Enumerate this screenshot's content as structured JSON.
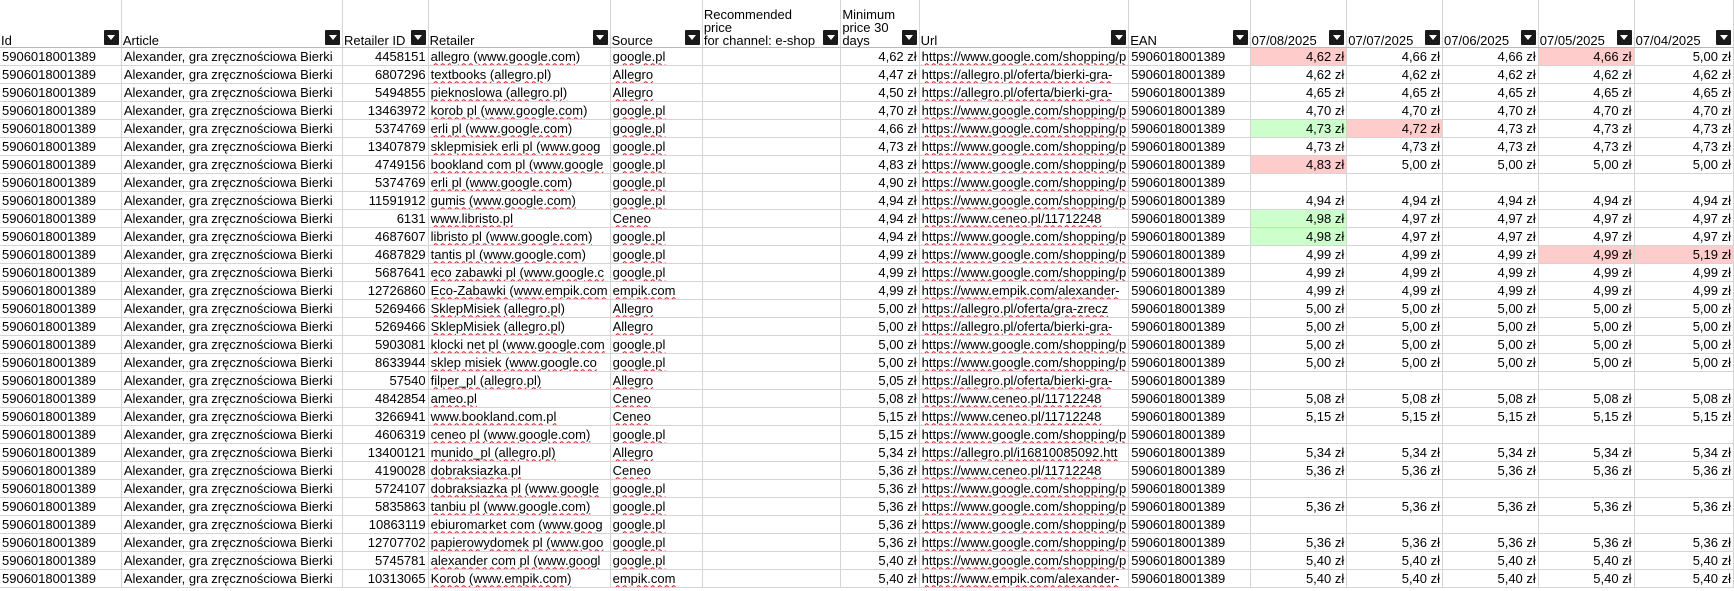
{
  "sheet": {
    "columns": [
      {
        "key": "id",
        "label": "Id"
      },
      {
        "key": "article",
        "label": "Article"
      },
      {
        "key": "retailer_id",
        "label": "Retailer ID"
      },
      {
        "key": "retailer",
        "label": "Retailer"
      },
      {
        "key": "source",
        "label": "Source"
      },
      {
        "key": "recommended",
        "label": "Recommended price\nfor channel: e-shop"
      },
      {
        "key": "min30",
        "label": "Minimum\nprice 30\ndays"
      },
      {
        "key": "url",
        "label": "Url"
      },
      {
        "key": "ean",
        "label": "EAN"
      },
      {
        "key": "d1",
        "label": "07/08/2025"
      },
      {
        "key": "d2",
        "label": "07/07/2025"
      },
      {
        "key": "d3",
        "label": "07/06/2025"
      },
      {
        "key": "d4",
        "label": "07/05/2025"
      },
      {
        "key": "d5",
        "label": "07/04/2025"
      }
    ],
    "rows": [
      [
        "5906018001389",
        "Alexander, gra zręcznościowa Bierki",
        "4458151",
        "allegro (www.google.com)",
        "google.pl",
        "",
        "4,62 zł",
        "https://www.google.com/shopping/p",
        "5906018001389",
        "4,62 zł",
        "4,66 zł",
        "4,66 zł",
        "4,66 zł",
        "5,00 zł"
      ],
      [
        "5906018001389",
        "Alexander, gra zręcznościowa Bierki",
        "6807296",
        "textbooks (allegro.pl)",
        "Allegro",
        "",
        "4,47 zł",
        "https://allegro.pl/oferta/bierki-gra-",
        "5906018001389",
        "4,62 zł",
        "4,62 zł",
        "4,62 zł",
        "4,62 zł",
        "4,62 zł"
      ],
      [
        "5906018001389",
        "Alexander, gra zręcznościowa Bierki",
        "5494855",
        "pieknoslowa (allegro.pl)",
        "Allegro",
        "",
        "4,50 zł",
        "https://allegro.pl/oferta/bierki-gra-",
        "5906018001389",
        "4,65 zł",
        "4,65 zł",
        "4,65 zł",
        "4,65 zł",
        "4,65 zł"
      ],
      [
        "5906018001389",
        "Alexander, gra zręcznościowa Bierki",
        "13463972",
        "korob pl (www.google.com)",
        "google.pl",
        "",
        "4,70 zł",
        "https://www.google.com/shopping/p",
        "5906018001389",
        "4,70 zł",
        "4,70 zł",
        "4,70 zł",
        "4,70 zł",
        "4,70 zł"
      ],
      [
        "5906018001389",
        "Alexander, gra zręcznościowa Bierki",
        "5374769",
        "erli pl (www.google.com)",
        "google.pl",
        "",
        "4,66 zł",
        "https://www.google.com/shopping/p",
        "5906018001389",
        "4,73 zł",
        "4,72 zł",
        "4,73 zł",
        "4,73 zł",
        "4,73 zł"
      ],
      [
        "5906018001389",
        "Alexander, gra zręcznościowa Bierki",
        "13407879",
        "sklepmisiek erli pl (www.goog",
        "google.pl",
        "",
        "4,73 zł",
        "https://www.google.com/shopping/p",
        "5906018001389",
        "4,73 zł",
        "4,73 zł",
        "4,73 zł",
        "4,73 zł",
        "4,73 zł"
      ],
      [
        "5906018001389",
        "Alexander, gra zręcznościowa Bierki",
        "4749156",
        "bookland com pl (www.google",
        "google.pl",
        "",
        "4,83 zł",
        "https://www.google.com/shopping/p",
        "5906018001389",
        "4,83 zł",
        "5,00 zł",
        "5,00 zł",
        "5,00 zł",
        "5,00 zł"
      ],
      [
        "5906018001389",
        "Alexander, gra zręcznościowa Bierki",
        "5374769",
        "erli pl (www.google.com)",
        "google.pl",
        "",
        "4,90 zł",
        "https://www.google.com/shopping/p",
        "5906018001389",
        "",
        "",
        "",
        "",
        ""
      ],
      [
        "5906018001389",
        "Alexander, gra zręcznościowa Bierki",
        "11591912",
        "gumis (www.google.com)",
        "google.pl",
        "",
        "4,94 zł",
        "https://www.google.com/shopping/p",
        "5906018001389",
        "4,94 zł",
        "4,94 zł",
        "4,94 zł",
        "4,94 zł",
        "4,94 zł"
      ],
      [
        "5906018001389",
        "Alexander, gra zręcznościowa Bierki",
        "6131",
        "www.libristo.pl",
        "Ceneo",
        "",
        "4,94 zł",
        "https://www.ceneo.pl/11712248",
        "5906018001389",
        "4,98 zł",
        "4,97 zł",
        "4,97 zł",
        "4,97 zł",
        "4,97 zł"
      ],
      [
        "5906018001389",
        "Alexander, gra zręcznościowa Bierki",
        "4687607",
        "libristo pl (www.google.com)",
        "google.pl",
        "",
        "4,94 zł",
        "https://www.google.com/shopping/p",
        "5906018001389",
        "4,98 zł",
        "4,97 zł",
        "4,97 zł",
        "4,97 zł",
        "4,97 zł"
      ],
      [
        "5906018001389",
        "Alexander, gra zręcznościowa Bierki",
        "4687829",
        "tantis pl (www.google.com)",
        "google.pl",
        "",
        "4,99 zł",
        "https://www.google.com/shopping/p",
        "5906018001389",
        "4,99 zł",
        "4,99 zł",
        "4,99 zł",
        "4,99 zł",
        "5,19 zł"
      ],
      [
        "5906018001389",
        "Alexander, gra zręcznościowa Bierki",
        "5687641",
        "eco zabawki pl (www.google.c",
        "google.pl",
        "",
        "4,99 zł",
        "https://www.google.com/shopping/p",
        "5906018001389",
        "4,99 zł",
        "4,99 zł",
        "4,99 zł",
        "4,99 zł",
        "4,99 zł"
      ],
      [
        "5906018001389",
        "Alexander, gra zręcznościowa Bierki",
        "12726860",
        "Eco-Zabawki (www.empik.com",
        "empik.com",
        "",
        "4,99 zł",
        "https://www.empik.com/alexander-",
        "5906018001389",
        "4,99 zł",
        "4,99 zł",
        "4,99 zł",
        "4,99 zł",
        "4,99 zł"
      ],
      [
        "5906018001389",
        "Alexander, gra zręcznościowa Bierki",
        "5269466",
        "SklepMisiek (allegro.pl)",
        "Allegro",
        "",
        "5,00 zł",
        "https://allegro.pl/oferta/gra-zrecz",
        "5906018001389",
        "5,00 zł",
        "5,00 zł",
        "5,00 zł",
        "5,00 zł",
        "5,00 zł"
      ],
      [
        "5906018001389",
        "Alexander, gra zręcznościowa Bierki",
        "5269466",
        "SklepMisiek (allegro.pl)",
        "Allegro",
        "",
        "5,00 zł",
        "https://allegro.pl/oferta/bierki-gra-",
        "5906018001389",
        "5,00 zł",
        "5,00 zł",
        "5,00 zł",
        "5,00 zł",
        "5,00 zł"
      ],
      [
        "5906018001389",
        "Alexander, gra zręcznościowa Bierki",
        "5903081",
        "klocki net pl (www.google.com",
        "google.pl",
        "",
        "5,00 zł",
        "https://www.google.com/shopping/p",
        "5906018001389",
        "5,00 zł",
        "5,00 zł",
        "5,00 zł",
        "5,00 zł",
        "5,00 zł"
      ],
      [
        "5906018001389",
        "Alexander, gra zręcznościowa Bierki",
        "8633944",
        "sklep misiek (www.google.co",
        "google.pl",
        "",
        "5,00 zł",
        "https://www.google.com/shopping/p",
        "5906018001389",
        "5,00 zł",
        "5,00 zł",
        "5,00 zł",
        "5,00 zł",
        "5,00 zł"
      ],
      [
        "5906018001389",
        "Alexander, gra zręcznościowa Bierki",
        "57540",
        "filper_pl (allegro.pl)",
        "Allegro",
        "",
        "5,05 zł",
        "https://allegro.pl/oferta/bierki-gra-",
        "5906018001389",
        "",
        "",
        "",
        "",
        ""
      ],
      [
        "5906018001389",
        "Alexander, gra zręcznościowa Bierki",
        "4842854",
        "ameo.pl",
        "Ceneo",
        "",
        "5,08 zł",
        "https://www.ceneo.pl/11712248",
        "5906018001389",
        "5,08 zł",
        "5,08 zł",
        "5,08 zł",
        "5,08 zł",
        "5,08 zł"
      ],
      [
        "5906018001389",
        "Alexander, gra zręcznościowa Bierki",
        "3266941",
        "www.bookland.com.pl",
        "Ceneo",
        "",
        "5,15 zł",
        "https://www.ceneo.pl/11712248",
        "5906018001389",
        "5,15 zł",
        "5,15 zł",
        "5,15 zł",
        "5,15 zł",
        "5,15 zł"
      ],
      [
        "5906018001389",
        "Alexander, gra zręcznościowa Bierki",
        "4606319",
        "ceneo pl (www.google.com)",
        "google.pl",
        "",
        "5,15 zł",
        "https://www.google.com/shopping/p",
        "5906018001389",
        "",
        "",
        "",
        "",
        ""
      ],
      [
        "5906018001389",
        "Alexander, gra zręcznościowa Bierki",
        "13400121",
        "munido_pl (allegro.pl)",
        "Allegro",
        "",
        "5,34 zł",
        "https://allegro.pl/i16810085092.htt",
        "5906018001389",
        "5,34 zł",
        "5,34 zł",
        "5,34 zł",
        "5,34 zł",
        "5,34 zł"
      ],
      [
        "5906018001389",
        "Alexander, gra zręcznościowa Bierki",
        "4190028",
        "dobraksiazka.pl",
        "Ceneo",
        "",
        "5,36 zł",
        "https://www.ceneo.pl/11712248",
        "5906018001389",
        "5,36 zł",
        "5,36 zł",
        "5,36 zł",
        "5,36 zł",
        "5,36 zł"
      ],
      [
        "5906018001389",
        "Alexander, gra zręcznościowa Bierki",
        "5724107",
        "dobraksiazka pl (www.google",
        "google.pl",
        "",
        "5,36 zł",
        "https://www.google.com/shopping/p",
        "5906018001389",
        "",
        "",
        "",
        "",
        ""
      ],
      [
        "5906018001389",
        "Alexander, gra zręcznościowa Bierki",
        "5835863",
        "tanbiu pl (www.google.com)",
        "google.pl",
        "",
        "5,36 zł",
        "https://www.google.com/shopping/p",
        "5906018001389",
        "5,36 zł",
        "5,36 zł",
        "5,36 zł",
        "5,36 zł",
        "5,36 zł"
      ],
      [
        "5906018001389",
        "Alexander, gra zręcznościowa Bierki",
        "10863119",
        "ebiuromarket com (www.goog",
        "google.pl",
        "",
        "5,36 zł",
        "https://www.google.com/shopping/p",
        "5906018001389",
        "",
        "",
        "",
        "",
        ""
      ],
      [
        "5906018001389",
        "Alexander, gra zręcznościowa Bierki",
        "12707702",
        "papierowydomek pl (www.goo",
        "google.pl",
        "",
        "5,36 zł",
        "https://www.google.com/shopping/p",
        "5906018001389",
        "5,36 zł",
        "5,36 zł",
        "5,36 zł",
        "5,36 zł",
        "5,36 zł"
      ],
      [
        "5906018001389",
        "Alexander, gra zręcznościowa Bierki",
        "5745781",
        "alexander com pl (www.googl",
        "google.pl",
        "",
        "5,40 zł",
        "https://www.google.com/shopping/p",
        "5906018001389",
        "5,40 zł",
        "5,40 zł",
        "5,40 zł",
        "5,40 zł",
        "5,40 zł"
      ],
      [
        "5906018001389",
        "Alexander, gra zręcznościowa Bierki",
        "10313065",
        "Korob (www.empik.com)",
        "empik.com",
        "",
        "5,40 zł",
        "https://www.empik.com/alexander-",
        "5906018001389",
        "5,40 zł",
        "5,40 zł",
        "5,40 zł",
        "5,40 zł",
        "5,40 zł"
      ]
    ],
    "highlights": [
      {
        "row": 0,
        "col": 9,
        "color": "red"
      },
      {
        "row": 0,
        "col": 12,
        "color": "red"
      },
      {
        "row": 4,
        "col": 9,
        "color": "green"
      },
      {
        "row": 4,
        "col": 10,
        "color": "red"
      },
      {
        "row": 6,
        "col": 9,
        "color": "red"
      },
      {
        "row": 9,
        "col": 9,
        "color": "green"
      },
      {
        "row": 10,
        "col": 9,
        "color": "green"
      },
      {
        "row": 11,
        "col": 12,
        "color": "red"
      },
      {
        "row": 11,
        "col": 13,
        "color": "red"
      }
    ],
    "colors": {
      "red_highlight": "#ffcccc",
      "green_highlight": "#ccffcc",
      "filter_button": "#1a1a1a",
      "grid_line": "#d4d4d4"
    }
  }
}
